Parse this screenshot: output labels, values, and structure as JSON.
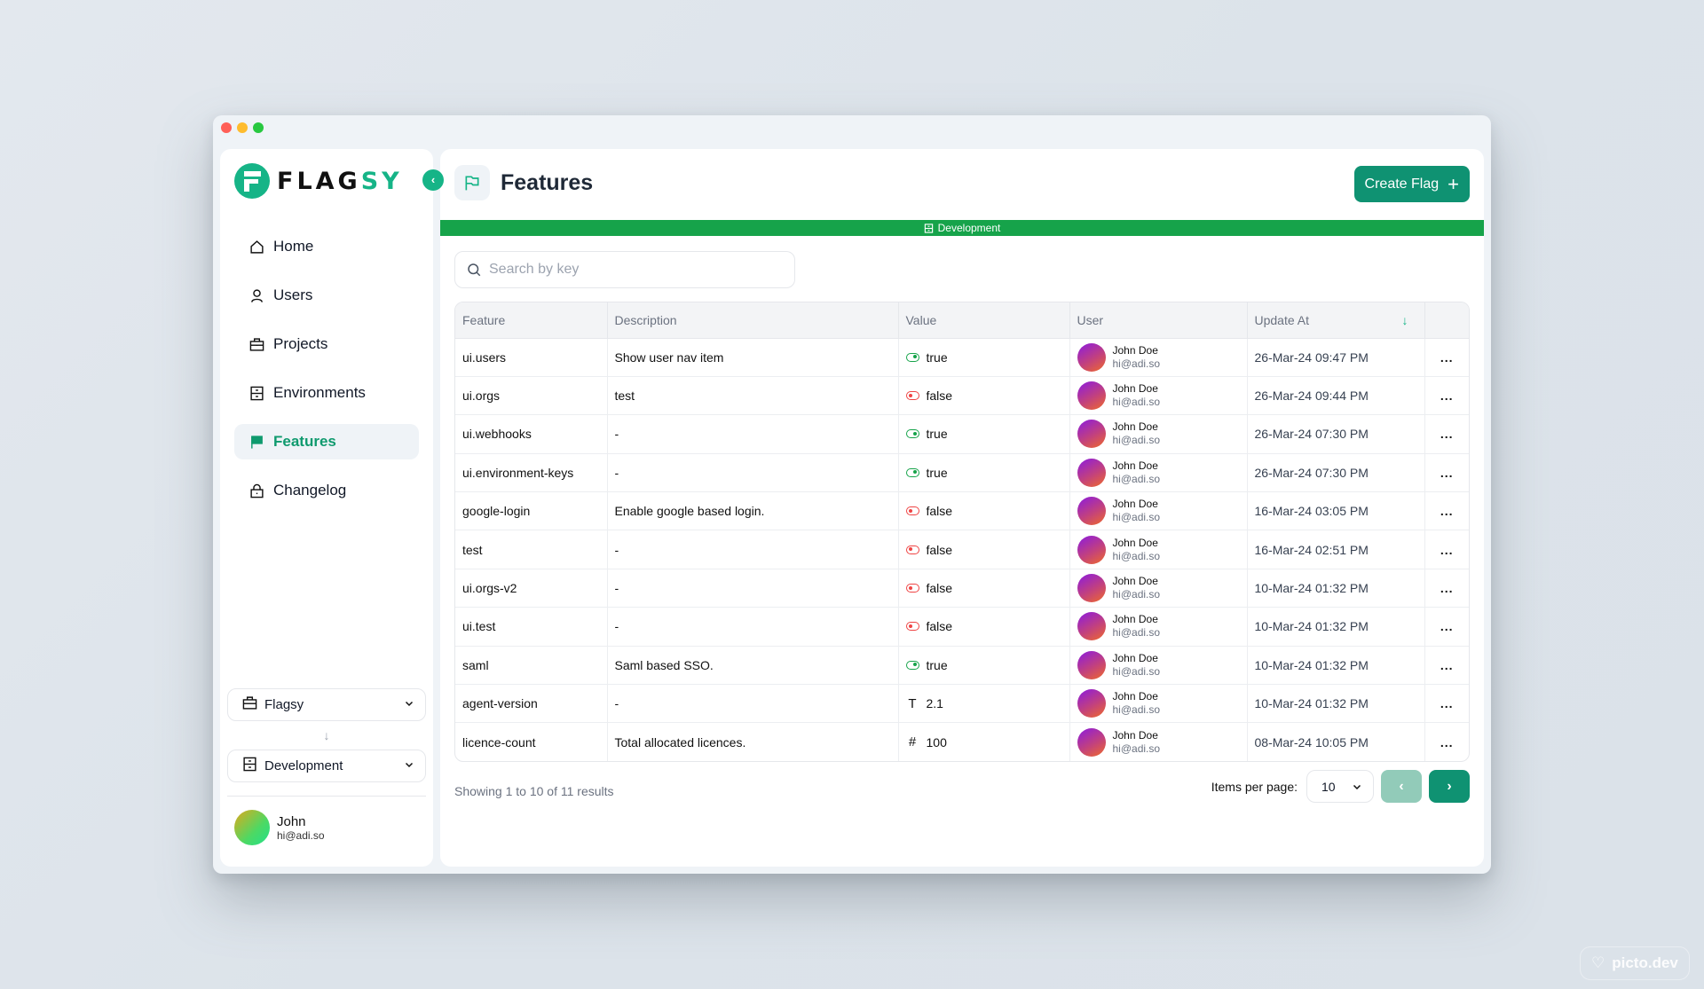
{
  "app": {
    "brand_prefix": "FLAG",
    "brand_suffix": "SY",
    "collapse_icon": "chevron-left-icon"
  },
  "sidebar": {
    "items": [
      {
        "label": "Home",
        "icon": "home-icon",
        "active": false
      },
      {
        "label": "Users",
        "icon": "user-icon",
        "active": false
      },
      {
        "label": "Projects",
        "icon": "briefcase-icon",
        "active": false
      },
      {
        "label": "Environments",
        "icon": "cabinet-icon",
        "active": false
      },
      {
        "label": "Features",
        "icon": "flag-icon",
        "active": true
      },
      {
        "label": "Changelog",
        "icon": "lock-icon",
        "active": false
      }
    ],
    "project_select": {
      "value": "Flagsy"
    },
    "environment_select": {
      "value": "Development"
    },
    "profile": {
      "name": "John",
      "email": "hi@adi.so"
    }
  },
  "header": {
    "title": "Features",
    "create_button": "Create Flag",
    "environment_banner": "Development"
  },
  "search": {
    "placeholder": "Search by key",
    "value": ""
  },
  "table": {
    "columns": [
      "Feature",
      "Description",
      "Value",
      "User",
      "Update At",
      ""
    ],
    "sort": {
      "column": "Update At",
      "direction": "desc"
    },
    "rows": [
      {
        "feature": "ui.users",
        "description": "Show user nav item",
        "type": "boolean",
        "value": "true",
        "user_name": "John Doe",
        "user_email": "hi@adi.so",
        "updated": "26-Mar-24 09:47 PM"
      },
      {
        "feature": "ui.orgs",
        "description": "test",
        "type": "boolean",
        "value": "false",
        "user_name": "John Doe",
        "user_email": "hi@adi.so",
        "updated": "26-Mar-24 09:44 PM"
      },
      {
        "feature": "ui.webhooks",
        "description": "-",
        "type": "boolean",
        "value": "true",
        "user_name": "John Doe",
        "user_email": "hi@adi.so",
        "updated": "26-Mar-24 07:30 PM"
      },
      {
        "feature": "ui.environment-keys",
        "description": "-",
        "type": "boolean",
        "value": "true",
        "user_name": "John Doe",
        "user_email": "hi@adi.so",
        "updated": "26-Mar-24 07:30 PM"
      },
      {
        "feature": "google-login",
        "description": "Enable google based login.",
        "type": "boolean",
        "value": "false",
        "user_name": "John Doe",
        "user_email": "hi@adi.so",
        "updated": "16-Mar-24 03:05 PM"
      },
      {
        "feature": "test",
        "description": "-",
        "type": "boolean",
        "value": "false",
        "user_name": "John Doe",
        "user_email": "hi@adi.so",
        "updated": "16-Mar-24 02:51 PM"
      },
      {
        "feature": "ui.orgs-v2",
        "description": "-",
        "type": "boolean",
        "value": "false",
        "user_name": "John Doe",
        "user_email": "hi@adi.so",
        "updated": "10-Mar-24 01:32 PM"
      },
      {
        "feature": "ui.test",
        "description": "-",
        "type": "boolean",
        "value": "false",
        "user_name": "John Doe",
        "user_email": "hi@adi.so",
        "updated": "10-Mar-24 01:32 PM"
      },
      {
        "feature": "saml",
        "description": "Saml based SSO.",
        "type": "boolean",
        "value": "true",
        "user_name": "John Doe",
        "user_email": "hi@adi.so",
        "updated": "10-Mar-24 01:32 PM"
      },
      {
        "feature": "agent-version",
        "description": "-",
        "type": "string",
        "value": "2.1",
        "user_name": "John Doe",
        "user_email": "hi@adi.so",
        "updated": "10-Mar-24 01:32 PM"
      },
      {
        "feature": "licence-count",
        "description": "Total allocated licences.",
        "type": "number",
        "value": "100",
        "user_name": "John Doe",
        "user_email": "hi@adi.so",
        "updated": "08-Mar-24 10:05 PM"
      }
    ],
    "row_action": "..."
  },
  "pagination": {
    "summary": "Showing 1 to 10 of 11 results",
    "items_per_page_label": "Items per page:",
    "items_per_page": "10",
    "prev_disabled": true,
    "next_disabled": false
  },
  "watermark": "picto.dev",
  "colors": {
    "accent": "#16b487",
    "button": "#0f9272",
    "env_banner": "#16a34a",
    "true": "#16a34a",
    "false": "#ef4444"
  }
}
